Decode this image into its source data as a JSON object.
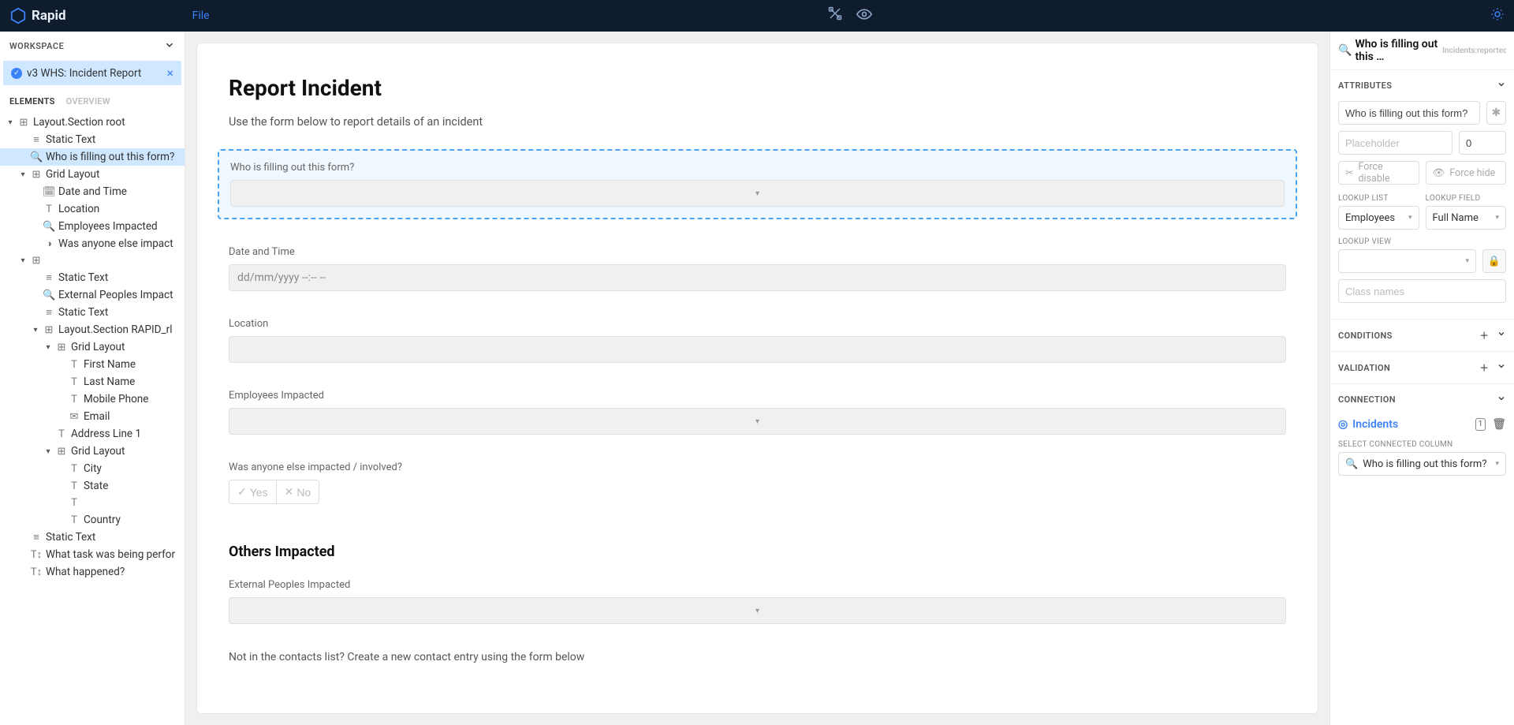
{
  "topbar": {
    "brand": "Rapid",
    "file_label": "File"
  },
  "workspace": {
    "header": "WORKSPACE",
    "tab_name": "v3 WHS: Incident Report"
  },
  "panel_tabs": {
    "elements": "ELEMENTS",
    "overview": "OVERVIEW"
  },
  "tree": [
    {
      "indent": 0,
      "caret": "v",
      "icon": "⊞",
      "label": "Layout.Section root"
    },
    {
      "indent": 1,
      "caret": "",
      "icon": "≡",
      "label": "Static Text"
    },
    {
      "indent": 1,
      "caret": "",
      "icon": "🔍",
      "label": "Who is filling out this form?",
      "selected": true
    },
    {
      "indent": 1,
      "caret": "v",
      "icon": "⊞",
      "label": "Grid Layout"
    },
    {
      "indent": 2,
      "caret": "",
      "icon": "🗓",
      "label": "Date and Time"
    },
    {
      "indent": 2,
      "caret": "",
      "icon": "T",
      "label": "Location"
    },
    {
      "indent": 2,
      "caret": "",
      "icon": "🔍",
      "label": "Employees Impacted"
    },
    {
      "indent": 2,
      "caret": "",
      "icon": "◑",
      "label": "Was anyone else impact"
    },
    {
      "indent": 1,
      "caret": "v",
      "icon": "⊞",
      "label": ""
    },
    {
      "indent": 2,
      "caret": "",
      "icon": "≡",
      "label": "Static Text"
    },
    {
      "indent": 2,
      "caret": "",
      "icon": "🔍",
      "label": "External Peoples Impact"
    },
    {
      "indent": 2,
      "caret": "",
      "icon": "≡",
      "label": "Static Text"
    },
    {
      "indent": 2,
      "caret": "v",
      "icon": "⊞",
      "label": "Layout.Section RAPID_rl"
    },
    {
      "indent": 3,
      "caret": "v",
      "icon": "⊞",
      "label": "Grid Layout"
    },
    {
      "indent": 4,
      "caret": "",
      "icon": "T",
      "label": "First Name"
    },
    {
      "indent": 4,
      "caret": "",
      "icon": "T",
      "label": "Last Name"
    },
    {
      "indent": 4,
      "caret": "",
      "icon": "T",
      "label": "Mobile Phone"
    },
    {
      "indent": 4,
      "caret": "",
      "icon": "✉",
      "label": "Email"
    },
    {
      "indent": 3,
      "caret": "",
      "icon": "T",
      "label": "Address Line 1"
    },
    {
      "indent": 3,
      "caret": "v",
      "icon": "⊞",
      "label": "Grid Layout"
    },
    {
      "indent": 4,
      "caret": "",
      "icon": "T",
      "label": "City"
    },
    {
      "indent": 4,
      "caret": "",
      "icon": "T",
      "label": "State"
    },
    {
      "indent": 4,
      "caret": "",
      "icon": "T",
      "label": ""
    },
    {
      "indent": 4,
      "caret": "",
      "icon": "T",
      "label": "Country"
    },
    {
      "indent": 1,
      "caret": "",
      "icon": "≡",
      "label": "Static Text"
    },
    {
      "indent": 1,
      "caret": "",
      "icon": "T↕",
      "label": "What task was being perfor"
    },
    {
      "indent": 1,
      "caret": "",
      "icon": "T↕",
      "label": "What happened?"
    }
  ],
  "canvas": {
    "title": "Report Incident",
    "subtitle": "Use the form below to report details of an incident",
    "fields": {
      "who": "Who is filling out this form?",
      "date": "Date and Time",
      "date_placeholder": "dd/mm/yyyy --:-- --",
      "location": "Location",
      "employees": "Employees Impacted",
      "anyone": "Was anyone else impacted / involved?",
      "yes": "Yes",
      "no": "No",
      "others_h": "Others Impacted",
      "external": "External Peoples Impacted",
      "not_in": "Not in the contacts list? Create a new contact entry using the form below"
    }
  },
  "right": {
    "head_text": "Who is filling out this …",
    "head_sub": "Incidents:reported_by_id",
    "attributes": "ATTRIBUTES",
    "attr_name": "Who is filling out this form?",
    "placeholder_ph": "Placeholder",
    "zero": "0",
    "force_disable": "Force disable",
    "force_hide": "Force hide",
    "lookup_list": "LOOKUP LIST",
    "lookup_list_val": "Employees",
    "lookup_field": "LOOKUP FIELD",
    "lookup_field_val": "Full Name",
    "lookup_view": "LOOKUP VIEW",
    "class_names_ph": "Class names",
    "conditions": "CONDITIONS",
    "validation": "VALIDATION",
    "connection": "CONNECTION",
    "incidents": "Incidents",
    "select_col": "SELECT CONNECTED COLUMN",
    "conn_val": "Who is filling out this form?"
  }
}
